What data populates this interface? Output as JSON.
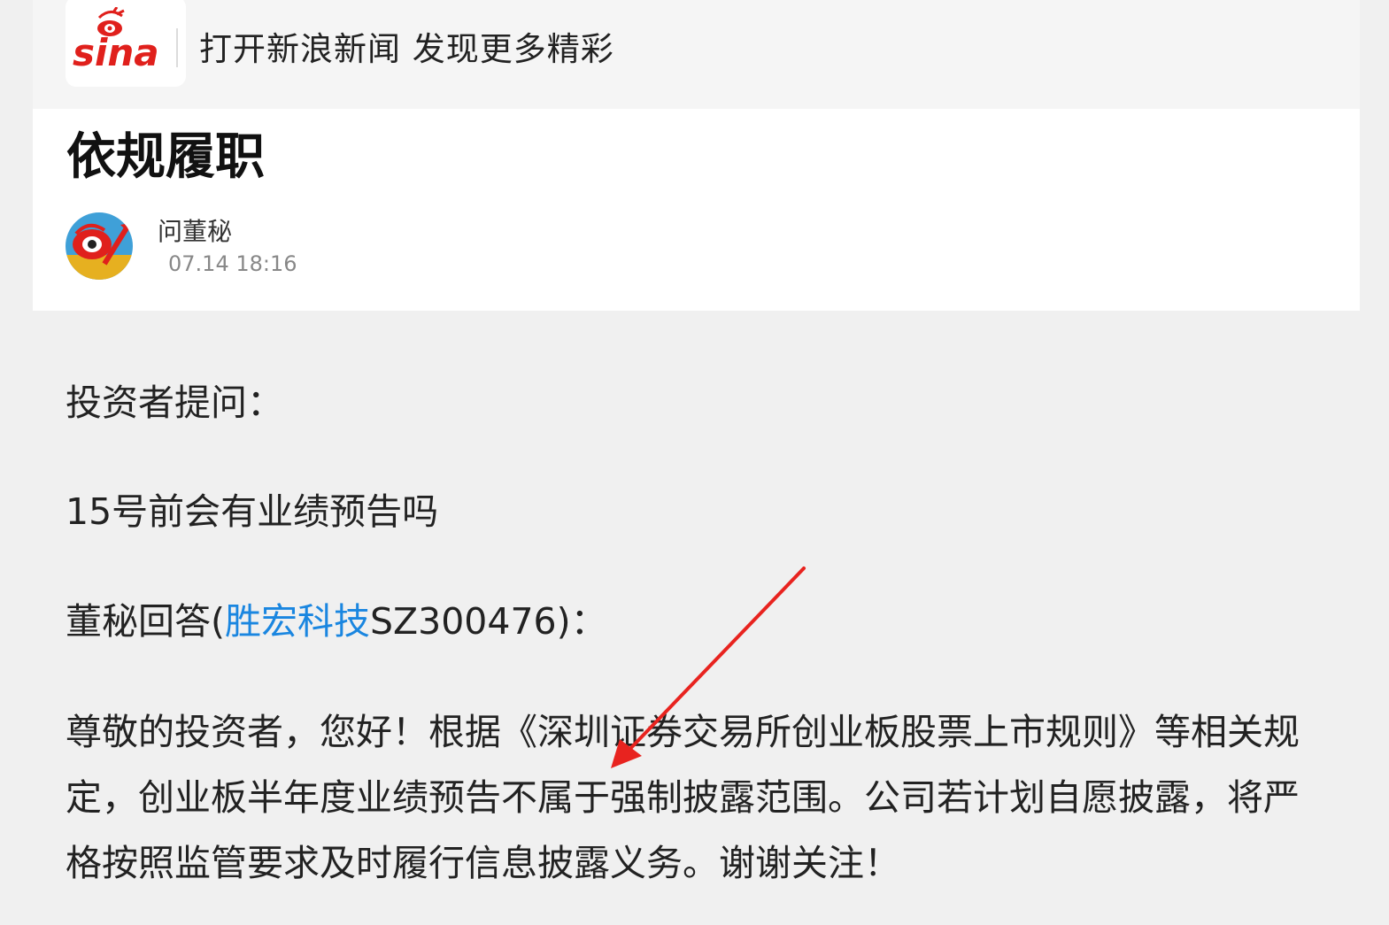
{
  "banner": {
    "logo_text": "sina",
    "text": "打开新浪新闻 发现更多精彩"
  },
  "article": {
    "title": "依规履职",
    "author": "问董秘",
    "time": "07.14  18:16",
    "question_label": "投资者提问：",
    "question": "15号前会有业绩预告吗",
    "answer_label_prefix": "董秘回答(",
    "company_link": "胜宏科技",
    "answer_label_suffix": "SZ300476)：",
    "answer": "尊敬的投资者，您好！根据《深圳证券交易所创业板股票上市规则》等相关规定，创业板半年度业绩预告不属于强制披露范围。公司若计划自愿披露，将严格按照监管要求及时履行信息披露义务。谢谢关注！"
  },
  "colors": {
    "link": "#1a86e0",
    "annotation_arrow": "#e8231f",
    "brand_red": "#e0201c"
  },
  "icons": {
    "logo": "sina-logo-icon",
    "avatar": "sina-eye-avatar-icon",
    "annotation": "red-arrow-annotation"
  }
}
